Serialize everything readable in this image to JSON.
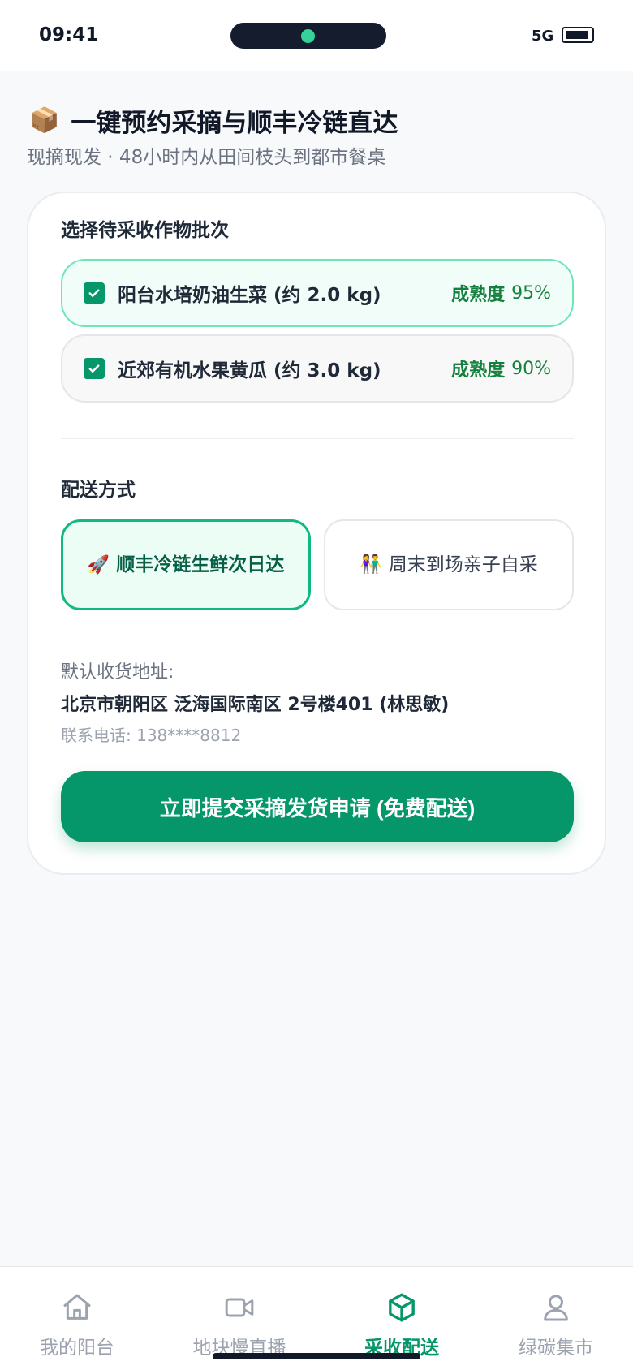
{
  "status_bar": {
    "time": "09:41",
    "network": "5G"
  },
  "header": {
    "emoji": "📦",
    "title": "一键预约采摘与顺丰冷链直达",
    "subtitle": "现摘现发 · 48小时内从田间枝头到都市餐桌"
  },
  "crops": {
    "section_label": "选择待采收作物批次",
    "items": [
      {
        "name": "阳台水培奶油生菜 (约 2.0 kg)",
        "ripeness_label": "成熟度",
        "ripeness_value": "95%",
        "checked": true
      },
      {
        "name": "近郊有机水果黄瓜 (约 3.0 kg)",
        "ripeness_label": "成熟度",
        "ripeness_value": "90%",
        "checked": true
      }
    ]
  },
  "delivery": {
    "section_label": "配送方式",
    "options": [
      {
        "emoji": "🚀",
        "label": "顺丰冷链生鲜次日达",
        "selected": true
      },
      {
        "emoji": "👫",
        "label": "周末到场亲子自采",
        "selected": false
      }
    ]
  },
  "address": {
    "label": "默认收货地址:",
    "main": "北京市朝阳区 泛海国际南区 2号楼401 (林思敏)",
    "phone": "联系电话: 138****8812"
  },
  "submit_label": "立即提交采摘发货申请 (免费配送)",
  "nav": {
    "items": [
      {
        "label": "我的阳台",
        "icon": "home-icon",
        "active": false
      },
      {
        "label": "地块慢直播",
        "icon": "video-icon",
        "active": false
      },
      {
        "label": "采收配送",
        "icon": "box-icon",
        "active": true
      },
      {
        "label": "绿碳集市",
        "icon": "user-icon",
        "active": false
      }
    ]
  },
  "colors": {
    "accent": "#059669",
    "accent_light": "#ecfdf5",
    "text_primary": "#111827",
    "text_muted": "#6b7280"
  }
}
